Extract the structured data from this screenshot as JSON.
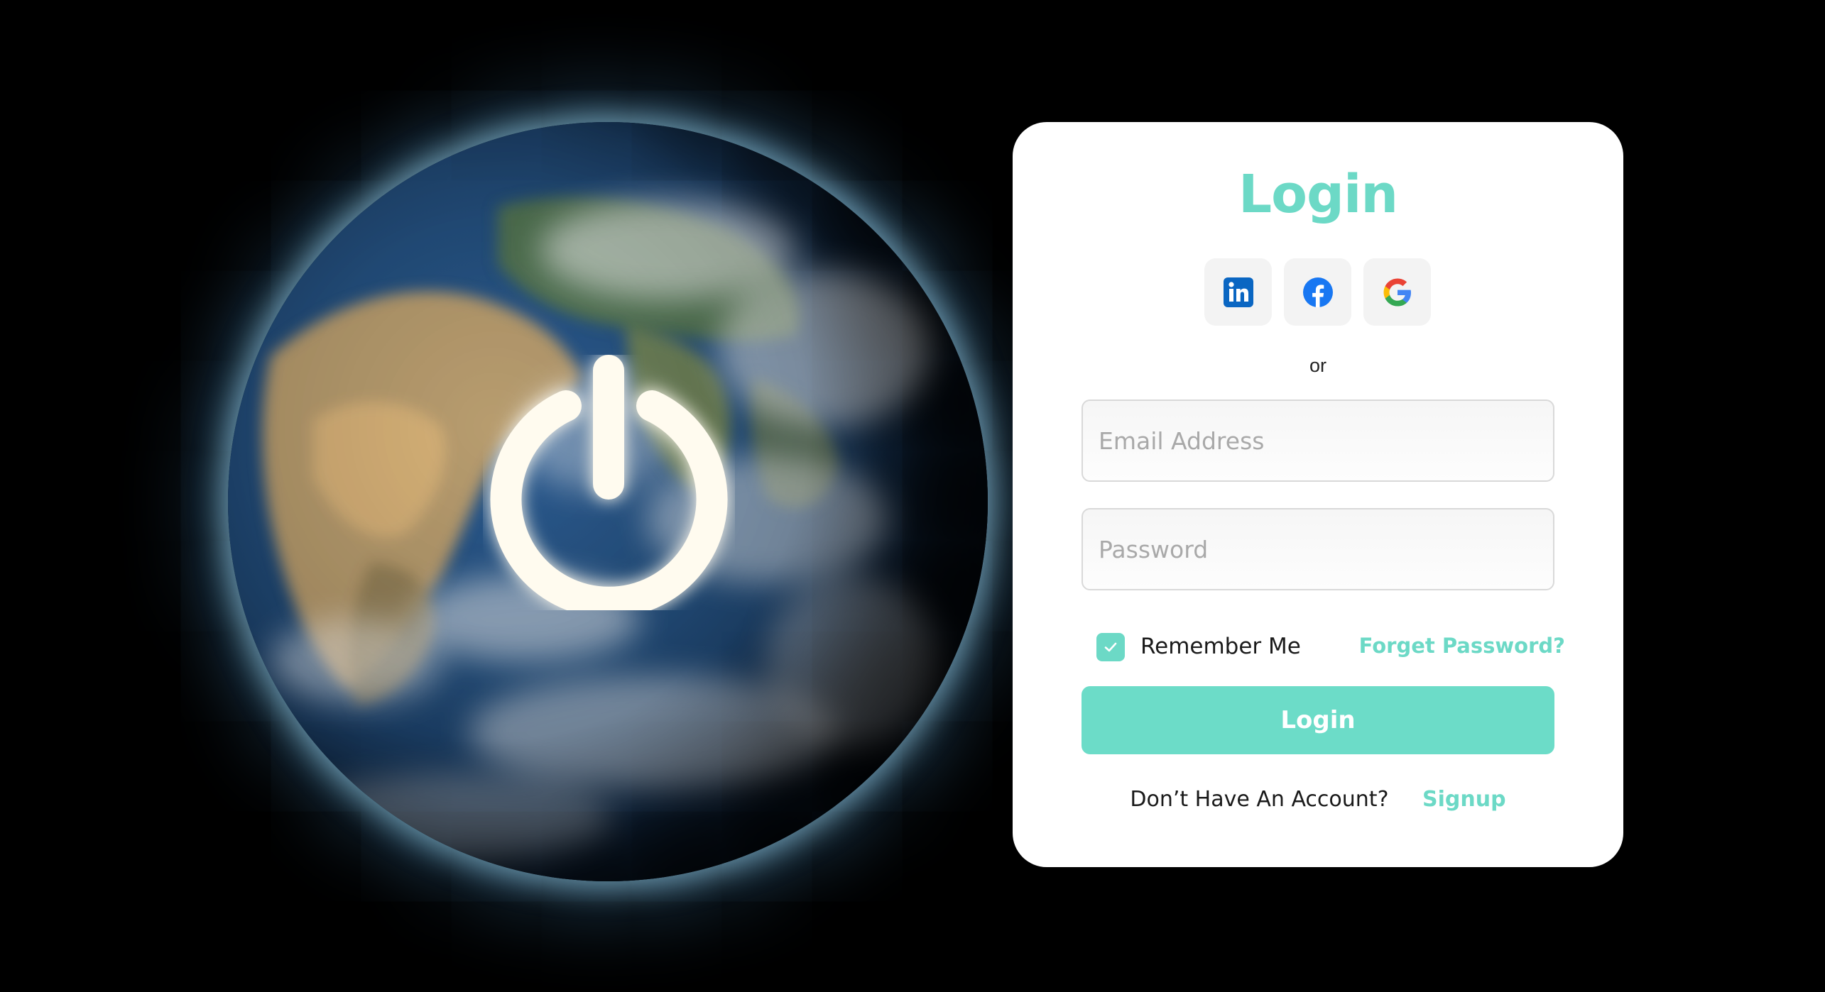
{
  "hero": {
    "illustration": "earth-globe",
    "icon": "power-icon"
  },
  "login_card": {
    "title": "Login",
    "social_buttons": [
      {
        "icon": "linkedin-icon",
        "color": "#0a66c2"
      },
      {
        "icon": "facebook-icon",
        "color": "#1877f2"
      },
      {
        "icon": "google-icon",
        "color": "#4285f4"
      }
    ],
    "separator": "or",
    "email": {
      "value": "",
      "placeholder": "Email Address"
    },
    "password": {
      "value": "",
      "placeholder": "Password"
    },
    "remember_me": {
      "label": "Remember Me",
      "checked": true
    },
    "forget_password": "Forget Password?",
    "login_button": "Login",
    "signup_prompt": "Don’t Have An Account?",
    "signup_link": "Signup"
  },
  "colors": {
    "accent": "#6cd9c6",
    "background": "#000000",
    "card": "#ffffff"
  }
}
